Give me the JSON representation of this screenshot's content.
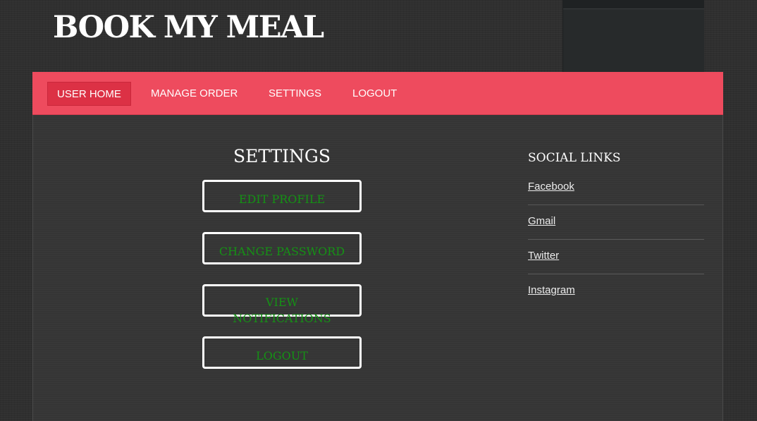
{
  "site": {
    "title": "BOOK MY MEAL"
  },
  "nav": {
    "items": [
      {
        "label": "USER HOME",
        "active": true
      },
      {
        "label": "MANAGE ORDER",
        "active": false
      },
      {
        "label": "SETTINGS",
        "active": false
      },
      {
        "label": "LOGOUT",
        "active": false
      }
    ]
  },
  "settings": {
    "heading": "SETTINGS",
    "buttons": [
      {
        "label": "EDIT PROFILE"
      },
      {
        "label": "CHANGE PASSWORD"
      },
      {
        "label": "VIEW NOTIFICATIONS"
      },
      {
        "label": "LOGOUT"
      }
    ]
  },
  "social": {
    "heading": "SOCIAL LINKS",
    "links": [
      {
        "label": "Facebook"
      },
      {
        "label": "Gmail"
      },
      {
        "label": "Twitter"
      },
      {
        "label": "Instagram"
      }
    ]
  },
  "colors": {
    "nav_bar": "#ee4b5e",
    "nav_active": "#dc3145",
    "button_text": "#159115",
    "background": "#2f2f2f"
  }
}
